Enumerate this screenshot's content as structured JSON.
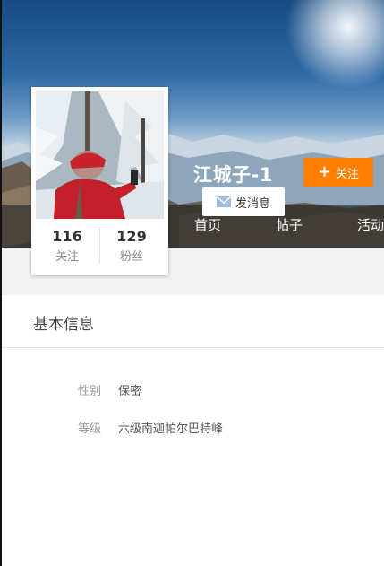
{
  "profile": {
    "name": "江城子-1",
    "follow_label": "关注",
    "message_label": "发消息",
    "stats": [
      {
        "count": "116",
        "label": "关注"
      },
      {
        "count": "129",
        "label": "粉丝"
      }
    ]
  },
  "tabs": [
    {
      "label": "首页"
    },
    {
      "label": "帖子"
    },
    {
      "label": "活动"
    }
  ],
  "basic_info": {
    "title": "基本信息",
    "rows": [
      {
        "label": "性别",
        "value": "保密"
      },
      {
        "label": "等级",
        "value": "六级南迦帕尔巴特峰"
      }
    ]
  },
  "colors": {
    "accent": "#ff7f00",
    "text_primary": "#333333",
    "text_secondary": "#9a9a9a"
  },
  "icons": [
    "plus-icon",
    "mail-icon"
  ]
}
